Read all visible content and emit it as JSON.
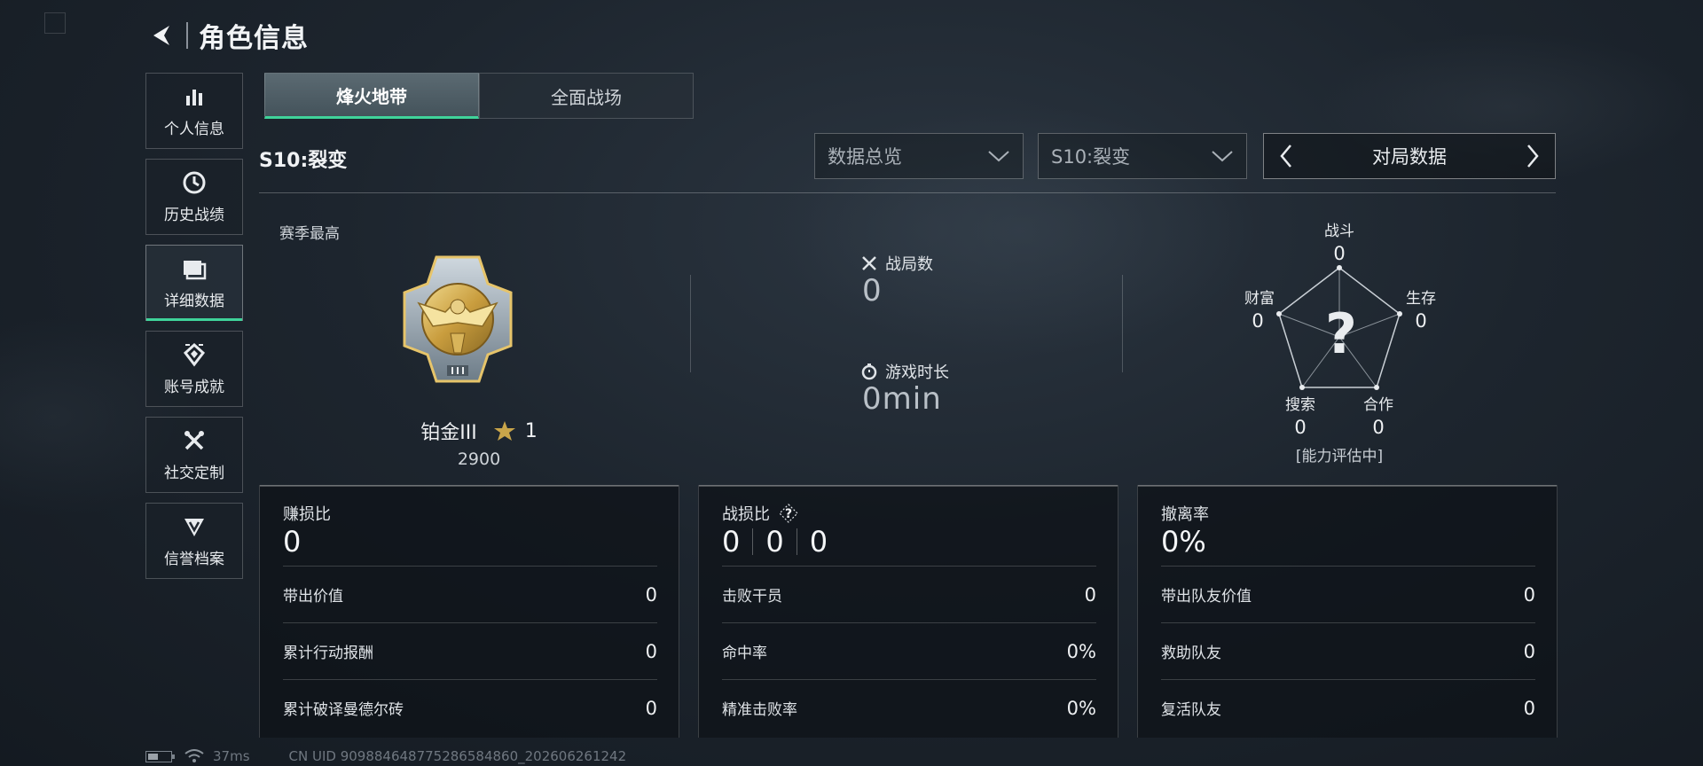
{
  "header": {
    "title": "角色信息"
  },
  "sidebar": {
    "items": [
      {
        "label": "个人信息",
        "icon": "bar-chart-icon"
      },
      {
        "label": "历史战绩",
        "icon": "clock-icon"
      },
      {
        "label": "详细数据",
        "icon": "folder-icon",
        "active": true
      },
      {
        "label": "账号成就",
        "icon": "achievement-icon"
      },
      {
        "label": "社交定制",
        "icon": "tools-icon"
      },
      {
        "label": "信誉档案",
        "icon": "shield-icon"
      }
    ]
  },
  "tabs": [
    {
      "label": "烽火地带",
      "active": true
    },
    {
      "label": "全面战场",
      "active": false
    }
  ],
  "season_label": "S10:裂变",
  "filters": {
    "overview": "数据总览",
    "season": "S10:裂变",
    "match_data": "对局数据"
  },
  "rank": {
    "section_label": "赛季最高",
    "tier": "铂金III",
    "stars": "1",
    "score": "2900"
  },
  "stats": {
    "matches_label": "战局数",
    "matches_value": "0",
    "playtime_label": "游戏时长",
    "playtime_value": "0min"
  },
  "radar": {
    "combat_label": "战斗",
    "combat_value": "0",
    "survival_label": "生存",
    "survival_value": "0",
    "cooperation_label": "合作",
    "cooperation_value": "0",
    "search_label": "搜索",
    "search_value": "0",
    "wealth_label": "财富",
    "wealth_value": "0",
    "center_mark": "?",
    "note": "[能力评估中]"
  },
  "cards": {
    "profit": {
      "title": "赚损比",
      "value": "0",
      "rows": [
        {
          "label": "带出价值",
          "value": "0"
        },
        {
          "label": "累计行动报酬",
          "value": "0"
        },
        {
          "label": "累计破译曼德尔砖",
          "value": "0"
        }
      ]
    },
    "kd": {
      "title": "战损比",
      "values": [
        "0",
        "0",
        "0"
      ],
      "rows": [
        {
          "label": "击败干员",
          "value": "0"
        },
        {
          "label": "命中率",
          "value": "0%"
        },
        {
          "label": "精准击败率",
          "value": "0%"
        }
      ]
    },
    "extract": {
      "title": "撤离率",
      "value": "0%",
      "rows": [
        {
          "label": "带出队友价值",
          "value": "0"
        },
        {
          "label": "救助队友",
          "value": "0"
        },
        {
          "label": "复活队友",
          "value": "0"
        }
      ]
    }
  },
  "status": {
    "ping": "37ms",
    "battery_level": 0.45,
    "uid": "CN UID 909884648775286584860_202606261242"
  },
  "colors": {
    "accent": "#3fd39a",
    "gold": "#c9a54a"
  }
}
